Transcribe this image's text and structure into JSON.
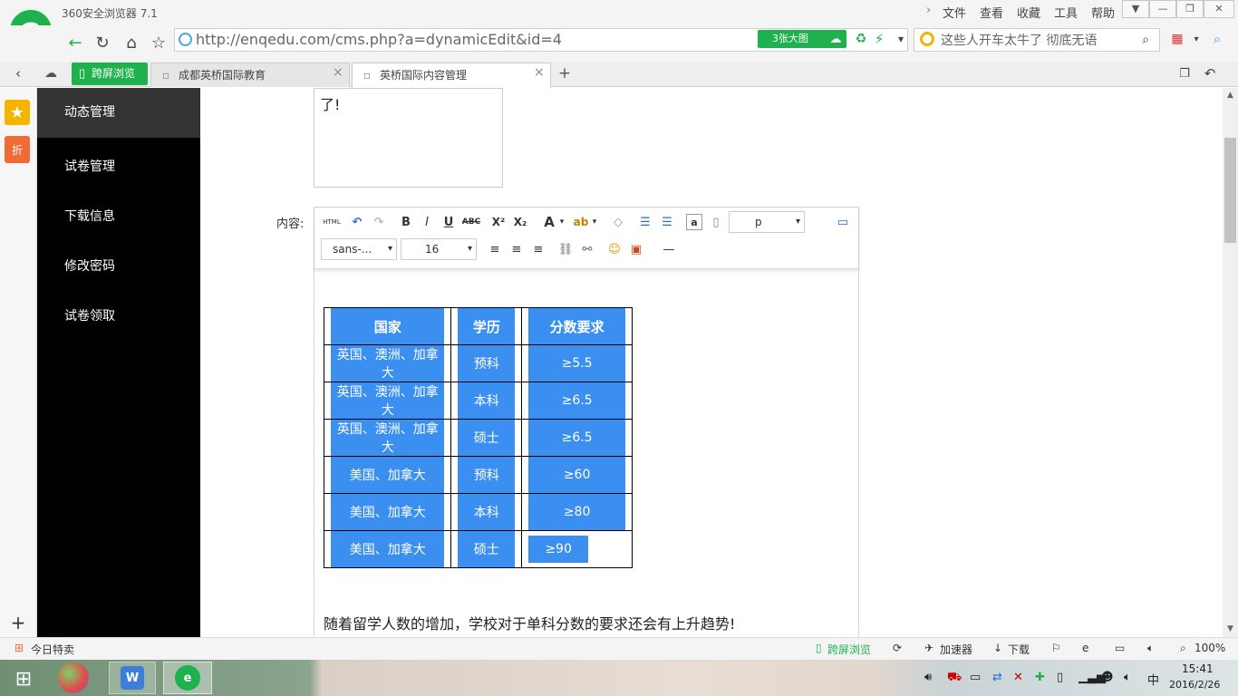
{
  "browser": {
    "app_version": "360安全浏览器 7.1",
    "menu": [
      "文件",
      "查看",
      "收藏",
      "工具",
      "帮助"
    ],
    "url": "http://enqedu.com/cms.php?a=dynamicEdit&id=4",
    "big_pic_label": "3张大图",
    "search_placeholder": "这些人开车太牛了 彻底无语",
    "cross_screen_label": "跨屏浏览",
    "tabs": [
      {
        "label": "成都英桥国际教育",
        "active": false
      },
      {
        "label": "英桥国际内容管理",
        "active": true
      }
    ],
    "status": {
      "today_deals": "今日特卖",
      "cross_screen": "跨屏浏览",
      "accelerator": "加速器",
      "download": "下载",
      "zoom": "100%"
    }
  },
  "left_strip": {
    "discount_label": "折"
  },
  "sidebar": {
    "items": [
      {
        "label": "动态管理",
        "active": true
      },
      {
        "label": "试卷管理",
        "active": false
      },
      {
        "label": "下载信息",
        "active": false
      },
      {
        "label": "修改密码",
        "active": false
      },
      {
        "label": "试卷领取",
        "active": false
      }
    ]
  },
  "form": {
    "summary_text": "了!",
    "content_label": "内容:",
    "toolbar": {
      "format_value": "p",
      "font_value": "sans-...",
      "size_value": "16"
    },
    "table": {
      "headers": [
        "国家",
        "学历",
        "分数要求"
      ],
      "rows": [
        [
          "英国、澳洲、加拿大",
          "预科",
          "≥5.5"
        ],
        [
          "英国、澳洲、加拿大",
          "本科",
          "≥6.5"
        ],
        [
          "英国、澳洲、加拿大",
          "硕士",
          "≥6.5"
        ],
        [
          "美国、加拿大",
          "预科",
          "≥60"
        ],
        [
          "美国、加拿大",
          "本科",
          "≥80"
        ],
        [
          "美国、加拿大",
          "硕士",
          "≥90"
        ]
      ]
    },
    "paragraph": "随着留学人数的增加，学校对于单科分数的要求还会有上升趋势!"
  },
  "taskbar": {
    "time": "15:41",
    "date": "2016/2/26",
    "ime": "中"
  },
  "colors": {
    "brand_green": "#1fb14e",
    "table_blue": "#3a8ff0",
    "sidebar_bg": "#000000"
  }
}
